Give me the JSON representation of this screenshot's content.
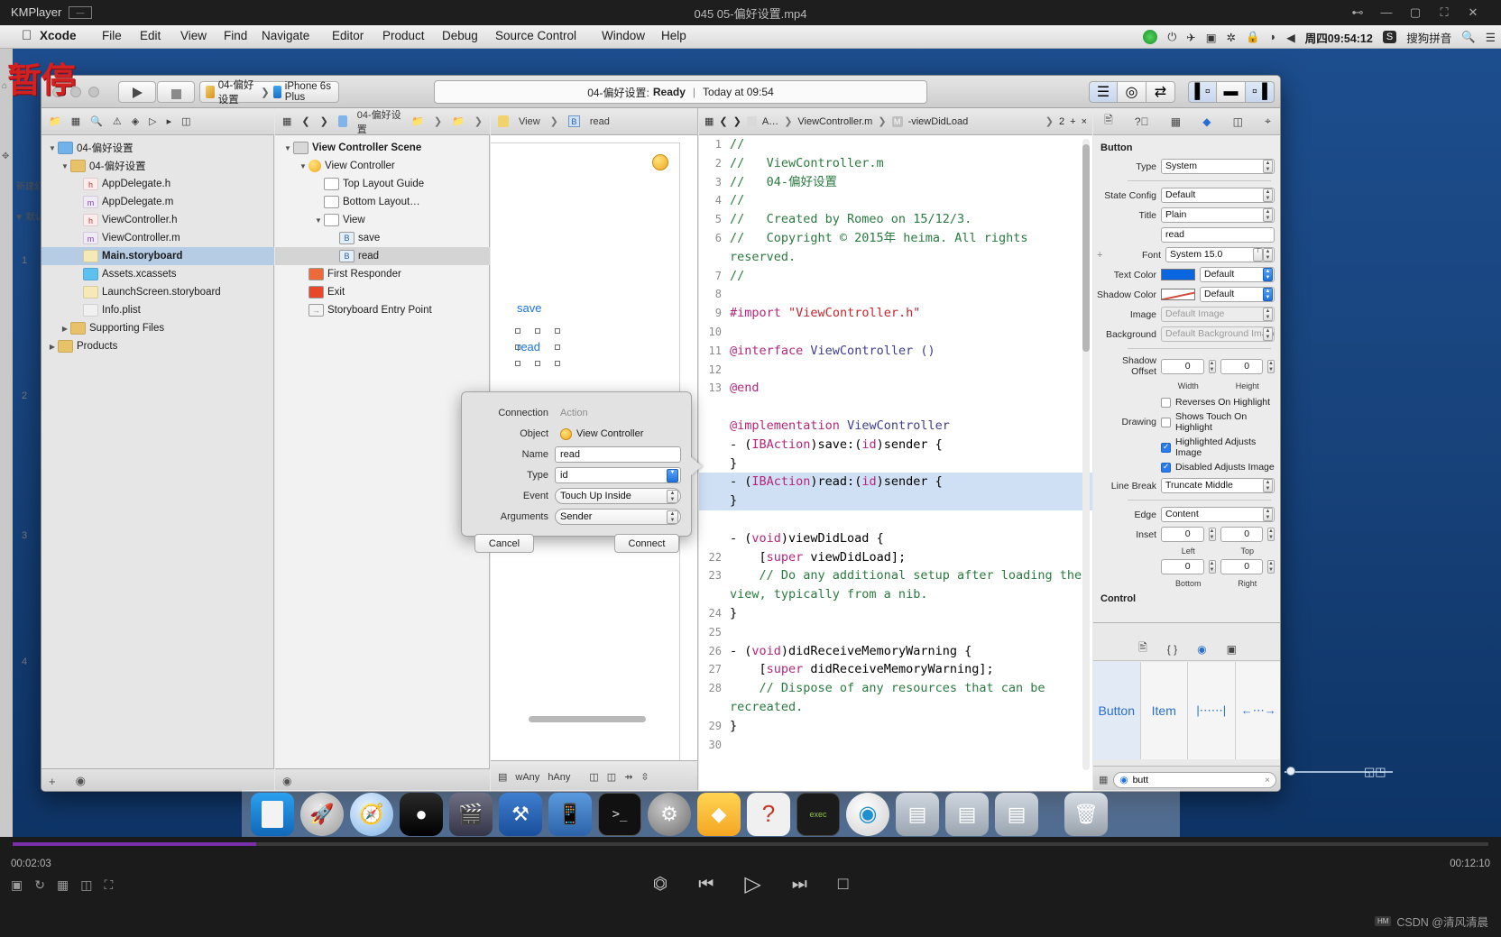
{
  "player": {
    "app_name": "KMPlayer",
    "badge": "—",
    "video_title": "045 05-偏好设置.mp4",
    "window_buttons": [
      "pip",
      "minimize",
      "maximize",
      "fullscreen",
      "close"
    ],
    "time_elapsed": "00:02:03",
    "time_total": "00:12:10",
    "pause_stamp": "暂停",
    "watermark": "CSDN @清风清晨",
    "watermark_badge": "HM",
    "controls": [
      "eject",
      "previous",
      "play",
      "next",
      "stop"
    ],
    "left_controls": [
      "capture",
      "loop",
      "gif",
      "3d",
      "crop"
    ]
  },
  "macos": {
    "apple_logo": "",
    "menus": [
      "Xcode",
      "File",
      "Edit",
      "View",
      "Find",
      "Navigate",
      "Editor",
      "Product",
      "Debug",
      "Source Control",
      "Window",
      "Help"
    ],
    "status_items": [
      "player-icon",
      "power-icon",
      "airplane-icon",
      "screen-record-icon",
      "bluetooth-icon",
      "lock-icon",
      "wifi-icon",
      "volume-icon"
    ],
    "clock": "周四09:54:12",
    "input_method": "搜狗拼音",
    "spotlight": "search-icon",
    "control_center": "list-icon"
  },
  "xcode": {
    "toolbar": {
      "run_label": "run",
      "stop_label": "stop",
      "scheme": "04-偏好设置",
      "device": "iPhone 6s Plus",
      "activity_project": "04-偏好设置:",
      "activity_status": "Ready",
      "activity_sep": "|",
      "activity_time": "Today at 09:54",
      "editor_modes": [
        "standard-editor",
        "assistant-editor",
        "version-editor"
      ],
      "view_modes": [
        "toggle-navigator",
        "toggle-debug-area",
        "toggle-utilities"
      ]
    },
    "navigator": {
      "tabs": [
        "project-navigator",
        "symbol-navigator",
        "find-navigator",
        "issue-navigator",
        "test-navigator",
        "debug-navigator",
        "breakpoint-navigator",
        "report-navigator"
      ],
      "items": [
        {
          "label": "04-偏好设置",
          "indent": 0,
          "twisty": "▼",
          "icon": "project-icon",
          "selected": false
        },
        {
          "label": "04-偏好设置",
          "indent": 1,
          "twisty": "▼",
          "icon": "folder-icon",
          "selected": false
        },
        {
          "label": "AppDelegate.h",
          "indent": 2,
          "twisty": "",
          "icon": "h-file-icon",
          "selected": false
        },
        {
          "label": "AppDelegate.m",
          "indent": 2,
          "twisty": "",
          "icon": "m-file-icon",
          "selected": false
        },
        {
          "label": "ViewController.h",
          "indent": 2,
          "twisty": "",
          "icon": "h-file-icon",
          "selected": false
        },
        {
          "label": "ViewController.m",
          "indent": 2,
          "twisty": "",
          "icon": "m-file-icon",
          "selected": false
        },
        {
          "label": "Main.storyboard",
          "indent": 2,
          "twisty": "",
          "icon": "storyboard-icon",
          "selected": true
        },
        {
          "label": "Assets.xcassets",
          "indent": 2,
          "twisty": "",
          "icon": "assets-icon",
          "selected": false
        },
        {
          "label": "LaunchScreen.storyboard",
          "indent": 2,
          "twisty": "",
          "icon": "storyboard-icon",
          "selected": false
        },
        {
          "label": "Info.plist",
          "indent": 2,
          "twisty": "",
          "icon": "plist-icon",
          "selected": false
        },
        {
          "label": "Supporting Files",
          "indent": 1,
          "twisty": "▶",
          "icon": "folder-icon",
          "selected": false
        },
        {
          "label": "Products",
          "indent": 0,
          "twisty": "▶",
          "icon": "folder-icon",
          "selected": false
        }
      ],
      "footer_add": "+",
      "footer_filter_placeholder": ""
    },
    "outline": {
      "items": [
        {
          "label": "View Controller Scene",
          "indent": 0,
          "twisty": "▼",
          "icon": "scene-icon",
          "bold": true,
          "selected": false
        },
        {
          "label": "View Controller",
          "indent": 1,
          "twisty": "▼",
          "icon": "view-controller-icon",
          "bold": false,
          "selected": false
        },
        {
          "label": "Top Layout Guide",
          "indent": 2,
          "twisty": "",
          "icon": "layout-guide-icon",
          "bold": false,
          "selected": false
        },
        {
          "label": "Bottom Layout…",
          "indent": 2,
          "twisty": "",
          "icon": "layout-guide-icon",
          "bold": false,
          "selected": false
        },
        {
          "label": "View",
          "indent": 2,
          "twisty": "▼",
          "icon": "view-icon",
          "bold": false,
          "selected": false
        },
        {
          "label": "save",
          "indent": 3,
          "twisty": "",
          "icon": "button-icon",
          "bold": false,
          "selected": false
        },
        {
          "label": "read",
          "indent": 3,
          "twisty": "",
          "icon": "button-icon",
          "bold": false,
          "selected": true
        },
        {
          "label": "First Responder",
          "indent": 1,
          "twisty": "",
          "icon": "first-responder-icon",
          "bold": false,
          "selected": false
        },
        {
          "label": "Exit",
          "indent": 1,
          "twisty": "",
          "icon": "exit-icon",
          "bold": false,
          "selected": false
        },
        {
          "label": "Storyboard Entry Point",
          "indent": 1,
          "twisty": "",
          "icon": "entry-point-icon",
          "bold": false,
          "selected": false
        }
      ]
    },
    "canvas": {
      "save_button_label": "save",
      "read_button_label": "read",
      "size_class_w": "wAny",
      "size_class_h": "hAny",
      "footer_icons": [
        "view-as",
        "embed-in",
        "align",
        "pin",
        "resolve",
        "resize"
      ]
    },
    "editor": {
      "jumpbar": [
        "A…",
        "ViewController.m",
        "-viewDidLoad"
      ],
      "jumpbar_counter": "2",
      "jumpbar_add": "+",
      "jumpbar_close": "×",
      "lines": [
        {
          "n": "1",
          "text": "//",
          "style": "cmt",
          "hl": false
        },
        {
          "n": "2",
          "text": "//   ViewController.m",
          "style": "cmt",
          "hl": false
        },
        {
          "n": "3",
          "text": "//   04-偏好设置",
          "style": "cmt",
          "hl": false
        },
        {
          "n": "4",
          "text": "//",
          "style": "cmt",
          "hl": false
        },
        {
          "n": "5",
          "text": "//   Created by Romeo on 15/12/3.",
          "style": "cmt",
          "hl": false
        },
        {
          "n": "6",
          "text": "//   Copyright © 2015年 heima. All rights reserved.",
          "style": "cmt",
          "hl": false
        },
        {
          "n": "7",
          "text": "//",
          "style": "cmt",
          "hl": false
        },
        {
          "n": "8",
          "text": "",
          "style": "",
          "hl": false
        },
        {
          "n": "9",
          "text": "#import \"ViewController.h\"",
          "style": "import",
          "hl": false
        },
        {
          "n": "10",
          "text": "",
          "style": "",
          "hl": false
        },
        {
          "n": "11",
          "text": "@interface ViewController ()",
          "style": "decl",
          "hl": false
        },
        {
          "n": "12",
          "text": "",
          "style": "",
          "hl": false
        },
        {
          "n": "13",
          "text": "@end",
          "style": "kw",
          "hl": false
        },
        {
          "n": "",
          "text": "",
          "style": "",
          "hl": false
        },
        {
          "n": "",
          "text": "@implementation ViewController",
          "style": "decl",
          "hl": false
        },
        {
          "n": "",
          "text": "- (IBAction)save:(id)sender {",
          "style": "method",
          "hl": false
        },
        {
          "n": "",
          "text": "}",
          "style": "",
          "hl": false
        },
        {
          "n": "",
          "text": "- (IBAction)read:(id)sender {",
          "style": "method",
          "hl": true
        },
        {
          "n": "",
          "text": "}",
          "style": "",
          "hl": true
        },
        {
          "n": "",
          "text": "",
          "style": "",
          "hl": false
        },
        {
          "n": "",
          "text": "- (void)viewDidLoad {",
          "style": "method",
          "hl": false
        },
        {
          "n": "22",
          "text": "    [super viewDidLoad];",
          "style": "call",
          "hl": false
        },
        {
          "n": "23",
          "text": "    // Do any additional setup after loading the view, typically from a nib.",
          "style": "cmt",
          "hl": false
        },
        {
          "n": "24",
          "text": "}",
          "style": "",
          "hl": false
        },
        {
          "n": "25",
          "text": "",
          "style": "",
          "hl": false
        },
        {
          "n": "26",
          "text": "- (void)didReceiveMemoryWarning {",
          "style": "method",
          "hl": false
        },
        {
          "n": "27",
          "text": "    [super didReceiveMemoryWarning];",
          "style": "call",
          "hl": false
        },
        {
          "n": "28",
          "text": "    // Dispose of any resources that can be recreated.",
          "style": "cmt",
          "hl": false
        },
        {
          "n": "29",
          "text": "}",
          "style": "",
          "hl": false
        },
        {
          "n": "30",
          "text": "",
          "style": "",
          "hl": false
        }
      ]
    },
    "inspector": {
      "tabs": [
        "file-inspector",
        "quick-help-inspector",
        "identity-inspector",
        "attributes-inspector",
        "size-inspector",
        "connections-inspector"
      ],
      "section_title": "Button",
      "fields": [
        {
          "label": "Type",
          "value": "System",
          "kind": "popup"
        },
        {
          "label": "State Config",
          "value": "Default",
          "kind": "popup"
        },
        {
          "label": "Title",
          "value": "Plain",
          "kind": "popup"
        },
        {
          "label": "",
          "value": "read",
          "kind": "text"
        },
        {
          "label": "Font",
          "value": "System 15.0",
          "kind": "font"
        },
        {
          "label": "Text Color",
          "value": "Default",
          "kind": "color",
          "color": "#0a66e0"
        },
        {
          "label": "Shadow Color",
          "value": "Default",
          "kind": "shadowcolor"
        },
        {
          "label": "Image",
          "value": "Default Image",
          "kind": "combo-dim"
        },
        {
          "label": "Background",
          "value": "Default Background Image",
          "kind": "combo-dim"
        }
      ],
      "shadow_offset": {
        "label": "Shadow Offset",
        "width": "0",
        "height": "0",
        "w_sub": "Width",
        "h_sub": "Height"
      },
      "drawing": {
        "label": "Drawing",
        "options": [
          {
            "text": "Reverses On Highlight",
            "checked": false
          },
          {
            "text": "Shows Touch On Highlight",
            "checked": false
          },
          {
            "text": "Highlighted Adjusts Image",
            "checked": true
          },
          {
            "text": "Disabled Adjusts Image",
            "checked": true
          }
        ]
      },
      "line_break": {
        "label": "Line Break",
        "value": "Truncate Middle"
      },
      "edge": {
        "label": "Edge",
        "value": "Content"
      },
      "inset": {
        "label": "Inset",
        "left": "0",
        "top": "0",
        "bottom": "0",
        "right": "0",
        "left_sub": "Left",
        "top_sub": "Top",
        "bottom_sub": "Bottom",
        "right_sub": "Right"
      },
      "control_section": "Control"
    },
    "library": {
      "tabs": [
        "file-template-library",
        "code-snippet-library",
        "object-library",
        "media-library"
      ],
      "items": [
        {
          "label": "Button",
          "kind": "button",
          "selected": true
        },
        {
          "label": "Item",
          "kind": "bar-button-item",
          "selected": false
        },
        {
          "label": "",
          "kind": "fixed-space-bar-button-item",
          "selected": false
        },
        {
          "label": "",
          "kind": "flexible-space-bar-button-item",
          "selected": false
        }
      ],
      "search_value": "butt",
      "search_placeholder": "Filter",
      "search_clear": "×"
    }
  },
  "popover": {
    "rows": [
      {
        "label": "Connection",
        "value": "Action",
        "kind": "readonly"
      },
      {
        "label": "Object",
        "value": "View Controller",
        "kind": "object"
      },
      {
        "label": "Name",
        "value": "read",
        "kind": "text"
      },
      {
        "label": "Type",
        "value": "id",
        "kind": "combo-active"
      },
      {
        "label": "Event",
        "value": "Touch Up Inside",
        "kind": "popup"
      },
      {
        "label": "Arguments",
        "value": "Sender",
        "kind": "popup"
      }
    ],
    "cancel_label": "Cancel",
    "connect_label": "Connect"
  },
  "dock": {
    "items": [
      "finder",
      "launchpad",
      "safari",
      "mouse-app",
      "imovie",
      "xcode",
      "simulator",
      "terminal",
      "system-preferences",
      "sketch",
      "question-app",
      "exec-app",
      "app-icon",
      "window-1",
      "window-2",
      "window-3",
      "trash"
    ]
  },
  "colors": {
    "accent_blue": "#2a7bf0",
    "selection": "#b6cbe4",
    "code_highlight": "#cfe0f5",
    "comment_green": "#2a7a3f",
    "keyword_pink": "#b5267a",
    "string_red": "#c4252b",
    "progress_purple": "#7a2fa8",
    "stamp_red": "#d42020"
  }
}
